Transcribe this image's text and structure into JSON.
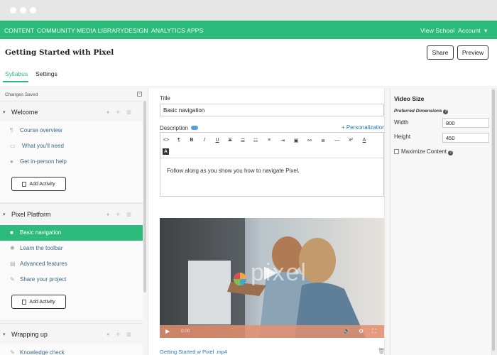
{
  "nav": {
    "items": [
      "CONTENT",
      "COMMUNITY",
      "MEDIA LIBRARY",
      "DESIGN",
      "ANALYTICS",
      "APPS"
    ],
    "view_school": "View School",
    "account": "Account",
    "account_chevron": "▾"
  },
  "header": {
    "title": "Getting Started with Pixel",
    "share_label": "Share",
    "preview_label": "Preview",
    "tabs": [
      "Syllabus",
      "Settings"
    ]
  },
  "sidebar": {
    "status": "Changes Saved",
    "collapse_glyph": "−",
    "add_activity_label": "Add Activity",
    "sections": [
      {
        "title": "Welcome",
        "items": [
          {
            "label": "Course overview",
            "icon": "paragraph-icon",
            "glyph": "¶"
          },
          {
            "label": "What you'll need",
            "icon": "monitor-icon",
            "glyph": "▭"
          },
          {
            "label": "Get in-person help",
            "icon": "globe-icon",
            "glyph": "●"
          }
        ]
      },
      {
        "title": "Pixel Platform",
        "items": [
          {
            "label": "Basic navigation",
            "icon": "video-icon",
            "glyph": "■",
            "active": true
          },
          {
            "label": "Learn the toolbar",
            "icon": "gear-icon",
            "glyph": "✺"
          },
          {
            "label": "Advanced features",
            "icon": "document-icon",
            "glyph": "▤"
          },
          {
            "label": "Share your project",
            "icon": "pencil-icon",
            "glyph": "✎"
          }
        ]
      },
      {
        "title": "Wrapping up",
        "items": [
          {
            "label": "Knowledge check",
            "icon": "quiz-icon",
            "glyph": "✎"
          }
        ]
      }
    ]
  },
  "main": {
    "title_label": "Title",
    "title_value": "Basic navigation",
    "description_label": "Description",
    "personalization": "+ Personalization",
    "toolbar_row1": [
      "<>",
      "¶",
      "B",
      "I",
      "U",
      "S",
      "☰",
      "☷",
      "≡",
      "⇥",
      "▣",
      "⚯",
      "≣",
      "—",
      "x²",
      "A"
    ],
    "toolbar_row2": [
      "A"
    ],
    "body_text": "Follow along as you show you how to navigate Pixel.",
    "video": {
      "time": "0:00",
      "logo_text": "pixel",
      "play_glyph": "▶",
      "volume_glyph": "🔊",
      "settings_glyph": "⚙",
      "fullscreen_glyph": "⛶"
    },
    "file_name": "Getting Started w Pixel .mp4",
    "trash_glyph": "🗑"
  },
  "right_panel": {
    "title": "Video Size",
    "preferred": "Preferred Dimensions",
    "help_glyph": "?",
    "width_label": "Width",
    "width_value": "800",
    "height_label": "Height",
    "height_value": "450",
    "maximize_label": "Maximize Content"
  },
  "colors": {
    "brand": "#2dbb7b",
    "link": "#2a7ab0",
    "video_bar": "#e48f6f"
  }
}
